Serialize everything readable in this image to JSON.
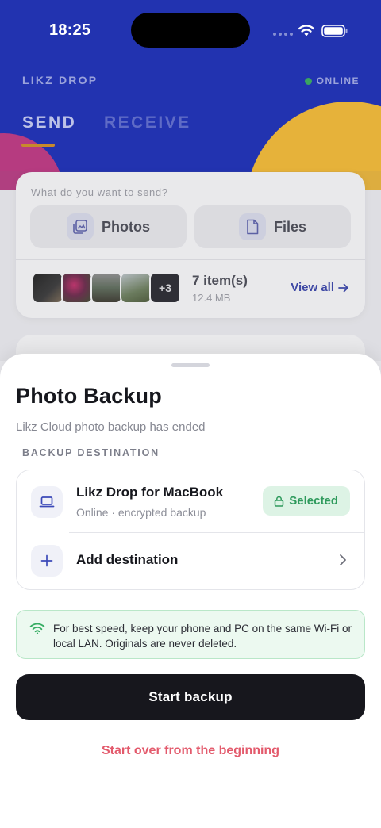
{
  "status_bar": {
    "time": "18:25"
  },
  "header": {
    "app_name": "LIKZ DROP",
    "status": "ONLINE"
  },
  "tabs": [
    {
      "label": "SEND",
      "active": true
    },
    {
      "label": "RECEIVE",
      "active": false
    }
  ],
  "send_card": {
    "question": "What do you want to send?",
    "photos_label": "Photos",
    "files_label": "Files",
    "more_count": "+3",
    "items_count": "7 item(s)",
    "items_size": "12.4 MB",
    "view_all": "View all"
  },
  "sheet": {
    "title": "Photo Backup",
    "subtitle": "Likz Cloud photo backup has ended",
    "section_label": "BACKUP DESTINATION",
    "destinations": [
      {
        "name": "Likz Drop for MacBook",
        "meta": "Online · encrypted backup",
        "badge": "Selected"
      }
    ],
    "add_destination": "Add destination",
    "tip": "For best speed, keep your phone and PC on the same Wi-Fi or local LAN. Originals are never deleted.",
    "start_button": "Start backup",
    "start_over": "Start over from the beginning"
  },
  "colors": {
    "brand_blue": "#2233b0",
    "accent_yellow": "#e6b23a",
    "online_green": "#3aa560",
    "success_green": "#2e9a5c",
    "danger_text": "#e35a6c",
    "primary_button": "#17171d"
  }
}
